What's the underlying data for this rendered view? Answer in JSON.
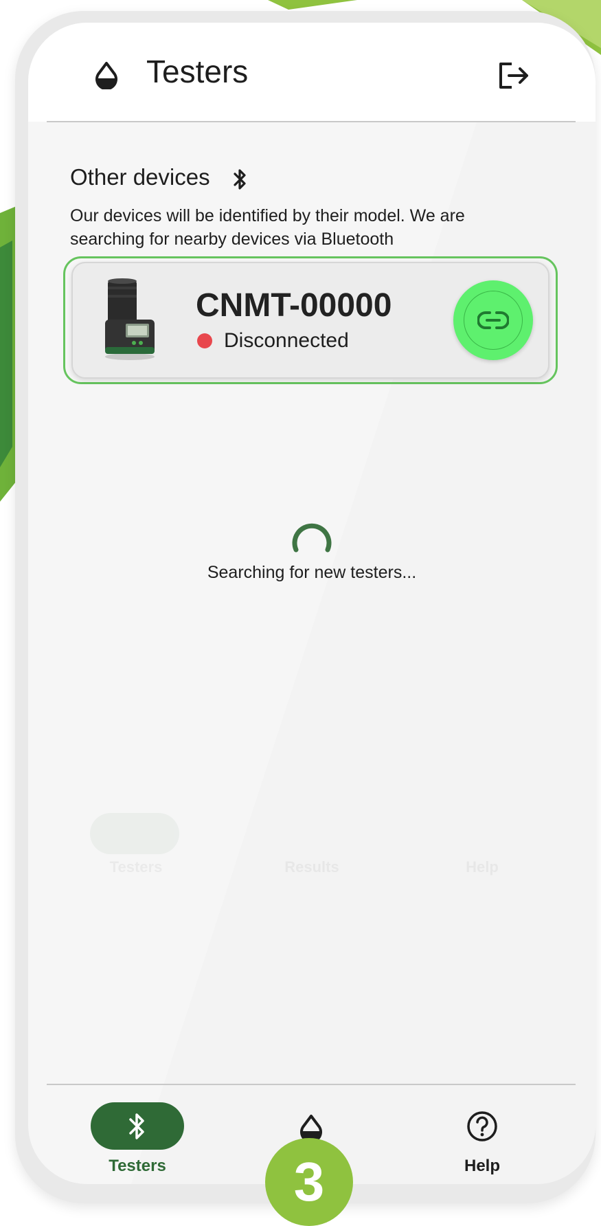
{
  "header": {
    "title": "Testers"
  },
  "section": {
    "title": "Other devices",
    "description": "Our devices will be identified by their model. We are searching for nearby devices via Bluetooth"
  },
  "device": {
    "name": "CNMT-00000",
    "status": "Disconnected",
    "status_color": "#e8474d"
  },
  "search": {
    "status_text": "Searching for new testers..."
  },
  "bottom_nav": {
    "items": [
      {
        "label": "Testers",
        "icon": "bluetooth-icon",
        "active": true
      },
      {
        "label": "",
        "icon": "drop-icon",
        "active": false
      },
      {
        "label": "Help",
        "icon": "help-icon",
        "active": false
      }
    ]
  },
  "ghost_nav": {
    "items": [
      {
        "label": "Testers"
      },
      {
        "label": "Results"
      },
      {
        "label": "Help"
      }
    ]
  },
  "badge": {
    "step": "3"
  },
  "colors": {
    "primary": "#2f6a36",
    "connect_button": "#5ef06e",
    "card_outline": "#66c45e",
    "badge": "#8fc23f"
  }
}
